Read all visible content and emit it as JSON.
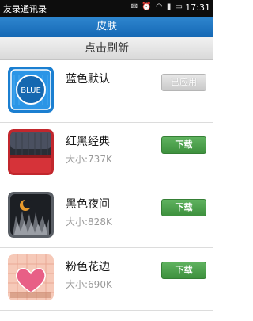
{
  "statusbar": {
    "app_name": "友录通讯录",
    "time": "17:31"
  },
  "titlebar": {
    "title": "皮肤"
  },
  "refresh": {
    "label": "点击刷新"
  },
  "skins": [
    {
      "name": "蓝色默认",
      "size": "",
      "button": "已应用",
      "state": "applied",
      "thumb_text": "BLUE"
    },
    {
      "name": "红黑经典",
      "size": "大小:737K",
      "button": "下载",
      "state": "download"
    },
    {
      "name": "黑色夜间",
      "size": "大小:828K",
      "button": "下载",
      "state": "download"
    },
    {
      "name": "粉色花边",
      "size": "大小:690K",
      "button": "下载",
      "state": "download"
    }
  ],
  "colors": {
    "titlebar": "#1a6fb8",
    "download": "#4a9e4a",
    "applied": "#d4d4d4"
  }
}
